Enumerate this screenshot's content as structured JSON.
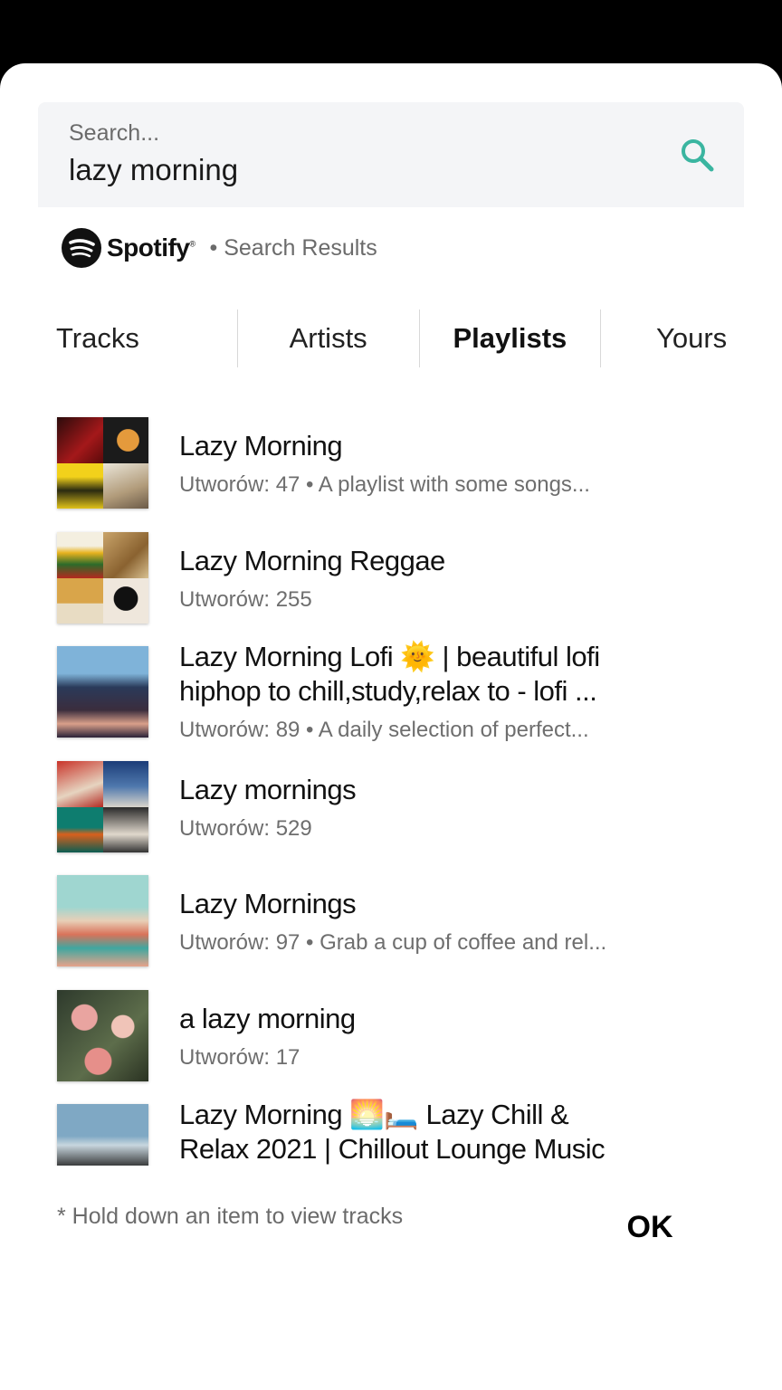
{
  "search": {
    "placeholder": "Search...",
    "value": "lazy morning"
  },
  "brand": {
    "name": "Spotify",
    "trademark": "®",
    "results_label": "• Search Results"
  },
  "tabs": [
    {
      "label": "Tracks"
    },
    {
      "label": "Artists"
    },
    {
      "label": "Playlists",
      "active": true
    },
    {
      "label": "Yours"
    }
  ],
  "playlists": [
    {
      "title": "Lazy Morning",
      "subtitle": "Utworów: 47 • A playlist with some songs..."
    },
    {
      "title": "Lazy Morning Reggae",
      "subtitle": "Utworów: 255"
    },
    {
      "title": "Lazy Morning Lofi 🌞 | beautiful lofi hiphop to chill,study,relax to - lofi ...",
      "subtitle": "Utworów: 89 • A daily selection of perfect..."
    },
    {
      "title": "Lazy mornings",
      "subtitle": "Utworów: 529"
    },
    {
      "title": "Lazy Mornings",
      "subtitle": "Utworów: 97 • Grab a cup of coffee and rel..."
    },
    {
      "title": "a lazy morning",
      "subtitle": "Utworów: 17"
    },
    {
      "title": "Lazy Morning 🌅🛏️ Lazy Chill & Relax 2021 | Chillout Lounge Music",
      "subtitle": ""
    }
  ],
  "footer": {
    "note": "* Hold down an item to view tracks",
    "ok_label": "OK"
  },
  "colors": {
    "accent": "#3ab5a0",
    "search_bg": "#f4f5f7",
    "overlay": "#000000"
  }
}
